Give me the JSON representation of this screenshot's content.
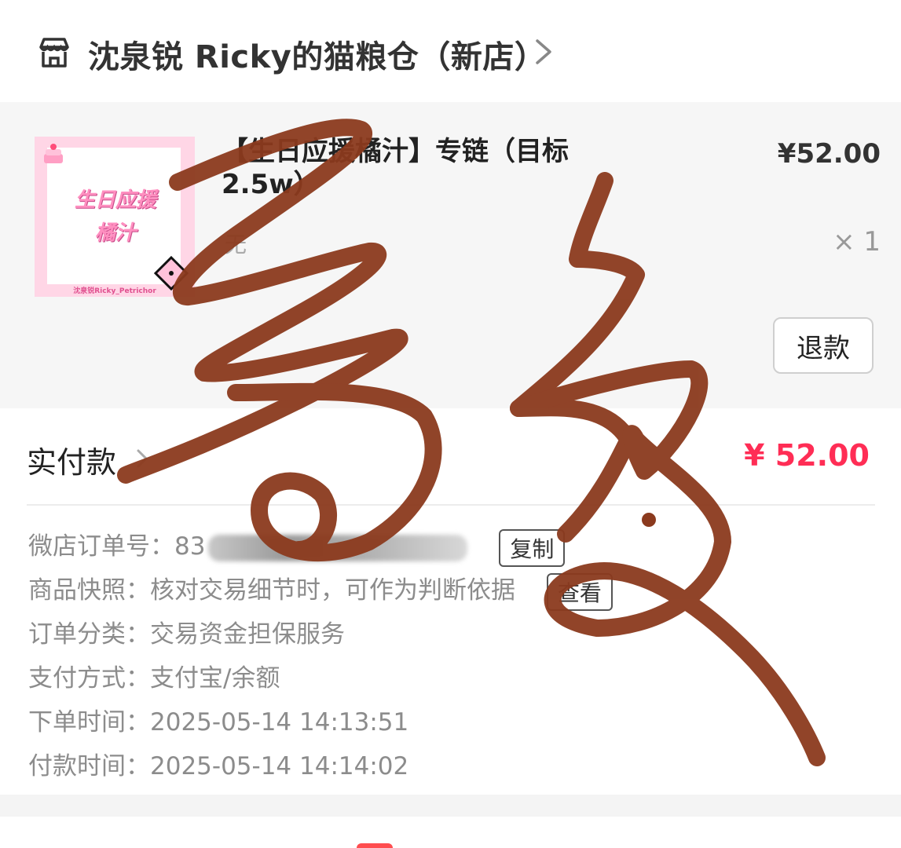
{
  "shop": {
    "name": "沈泉锐 Ricky的猫粮仓（新店）"
  },
  "product": {
    "thumb_text_line1": "生日应援",
    "thumb_text_line2": "橘汁",
    "thumb_caption": "沈泉锐Ricky_Petrichor",
    "title": "【生日应援橘汁】专链（目标2.5w）",
    "spec": "无",
    "price": "¥52.00",
    "quantity": "× 1",
    "refund_label": "退款"
  },
  "payment": {
    "label": "实付款",
    "amount": "¥ 52.00"
  },
  "details": {
    "order_no_label": "微店订单号：",
    "order_no_prefix": "83",
    "copy_label": "复制",
    "snapshot_label": "商品快照：",
    "snapshot_value": "核对交易细节时，可作为判断依据",
    "view_label": "查看",
    "category_label": "订单分类：",
    "category_value": "交易资金担保服务",
    "pay_method_label": "支付方式：",
    "pay_method_value": "支付宝/余额",
    "order_time_label": "下单时间：",
    "order_time_value": "2025-05-14 14:13:51",
    "pay_time_label": "付款时间：",
    "pay_time_value": "2025-05-14 14:14:02"
  },
  "colors": {
    "accent_price": "#ff2d55",
    "scribble": "#8b3a1e",
    "thumb_bg": "#ffd6e6"
  },
  "icons": {
    "shop": "storefront-icon",
    "chevron": "chevron-right-icon"
  }
}
